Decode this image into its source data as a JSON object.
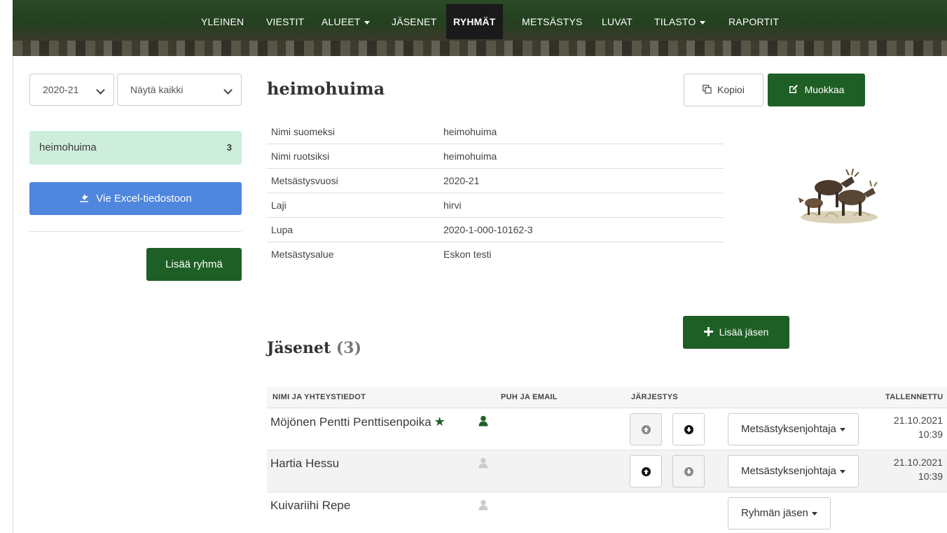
{
  "nav": {
    "items": [
      {
        "label": "YLEINEN"
      },
      {
        "label": "VIESTIT"
      },
      {
        "label": "ALUEET"
      },
      {
        "label": "JÄSENET"
      },
      {
        "label": "RYHMÄT"
      },
      {
        "label": "METSÄSTYS"
      },
      {
        "label": "LUVAT"
      },
      {
        "label": "TILASTO"
      },
      {
        "label": "RAPORTIT"
      }
    ],
    "active": "RYHMÄT"
  },
  "sidebar": {
    "season_select": "2020-21",
    "filter_select": "Näytä kaikki",
    "groups": [
      {
        "name": "heimohuima",
        "count": "3"
      }
    ],
    "excel_button": "Vie Excel-tiedostoon",
    "add_group_button": "Lisää ryhmä"
  },
  "group": {
    "title": "heimohuima",
    "copy_button": "Kopioi",
    "edit_button": "Muokkaa",
    "info": [
      {
        "key": "Nimi suomeksi",
        "value": "heimohuima"
      },
      {
        "key": "Nimi ruotsiksi",
        "value": "heimohuima"
      },
      {
        "key": "Metsästysvuosi",
        "value": "2020-21"
      },
      {
        "key": "Laji",
        "value": "hirvi"
      },
      {
        "key": "Lupa",
        "value": "2020-1-000-10162-3"
      },
      {
        "key": "Metsästysalue",
        "value": "Eskon testi"
      }
    ]
  },
  "members": {
    "heading": "Jäsenet",
    "count": "(3)",
    "add_button": "Lisää jäsen",
    "columns": [
      "NIMI JA YHTEYSTIEDOT",
      "PUH JA EMAIL",
      "JÄRJESTYS",
      "TALLENNETTU"
    ],
    "rows": [
      {
        "name": "Möjönen Pentti Penttisenpoika",
        "star": "★",
        "role": "Metsästyksenjohtaja",
        "saved_date": "21.10.2021",
        "saved_time": "10:39"
      },
      {
        "name": "Hartia Hessu",
        "role": "Metsästyksenjohtaja",
        "saved_date": "21.10.2021",
        "saved_time": "10:39"
      },
      {
        "name": "Kuivariihi Repe",
        "role": "Ryhmän jäsen"
      }
    ]
  }
}
